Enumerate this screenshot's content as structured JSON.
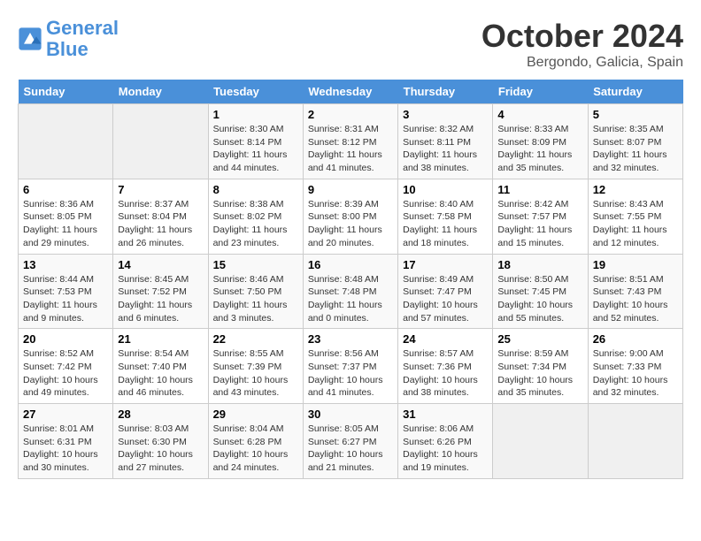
{
  "header": {
    "logo_line1": "General",
    "logo_line2": "Blue",
    "month": "October 2024",
    "location": "Bergondo, Galicia, Spain"
  },
  "weekdays": [
    "Sunday",
    "Monday",
    "Tuesday",
    "Wednesday",
    "Thursday",
    "Friday",
    "Saturday"
  ],
  "weeks": [
    [
      {
        "day": "",
        "info": ""
      },
      {
        "day": "",
        "info": ""
      },
      {
        "day": "1",
        "info": "Sunrise: 8:30 AM\nSunset: 8:14 PM\nDaylight: 11 hours and 44 minutes."
      },
      {
        "day": "2",
        "info": "Sunrise: 8:31 AM\nSunset: 8:12 PM\nDaylight: 11 hours and 41 minutes."
      },
      {
        "day": "3",
        "info": "Sunrise: 8:32 AM\nSunset: 8:11 PM\nDaylight: 11 hours and 38 minutes."
      },
      {
        "day": "4",
        "info": "Sunrise: 8:33 AM\nSunset: 8:09 PM\nDaylight: 11 hours and 35 minutes."
      },
      {
        "day": "5",
        "info": "Sunrise: 8:35 AM\nSunset: 8:07 PM\nDaylight: 11 hours and 32 minutes."
      }
    ],
    [
      {
        "day": "6",
        "info": "Sunrise: 8:36 AM\nSunset: 8:05 PM\nDaylight: 11 hours and 29 minutes."
      },
      {
        "day": "7",
        "info": "Sunrise: 8:37 AM\nSunset: 8:04 PM\nDaylight: 11 hours and 26 minutes."
      },
      {
        "day": "8",
        "info": "Sunrise: 8:38 AM\nSunset: 8:02 PM\nDaylight: 11 hours and 23 minutes."
      },
      {
        "day": "9",
        "info": "Sunrise: 8:39 AM\nSunset: 8:00 PM\nDaylight: 11 hours and 20 minutes."
      },
      {
        "day": "10",
        "info": "Sunrise: 8:40 AM\nSunset: 7:58 PM\nDaylight: 11 hours and 18 minutes."
      },
      {
        "day": "11",
        "info": "Sunrise: 8:42 AM\nSunset: 7:57 PM\nDaylight: 11 hours and 15 minutes."
      },
      {
        "day": "12",
        "info": "Sunrise: 8:43 AM\nSunset: 7:55 PM\nDaylight: 11 hours and 12 minutes."
      }
    ],
    [
      {
        "day": "13",
        "info": "Sunrise: 8:44 AM\nSunset: 7:53 PM\nDaylight: 11 hours and 9 minutes."
      },
      {
        "day": "14",
        "info": "Sunrise: 8:45 AM\nSunset: 7:52 PM\nDaylight: 11 hours and 6 minutes."
      },
      {
        "day": "15",
        "info": "Sunrise: 8:46 AM\nSunset: 7:50 PM\nDaylight: 11 hours and 3 minutes."
      },
      {
        "day": "16",
        "info": "Sunrise: 8:48 AM\nSunset: 7:48 PM\nDaylight: 11 hours and 0 minutes."
      },
      {
        "day": "17",
        "info": "Sunrise: 8:49 AM\nSunset: 7:47 PM\nDaylight: 10 hours and 57 minutes."
      },
      {
        "day": "18",
        "info": "Sunrise: 8:50 AM\nSunset: 7:45 PM\nDaylight: 10 hours and 55 minutes."
      },
      {
        "day": "19",
        "info": "Sunrise: 8:51 AM\nSunset: 7:43 PM\nDaylight: 10 hours and 52 minutes."
      }
    ],
    [
      {
        "day": "20",
        "info": "Sunrise: 8:52 AM\nSunset: 7:42 PM\nDaylight: 10 hours and 49 minutes."
      },
      {
        "day": "21",
        "info": "Sunrise: 8:54 AM\nSunset: 7:40 PM\nDaylight: 10 hours and 46 minutes."
      },
      {
        "day": "22",
        "info": "Sunrise: 8:55 AM\nSunset: 7:39 PM\nDaylight: 10 hours and 43 minutes."
      },
      {
        "day": "23",
        "info": "Sunrise: 8:56 AM\nSunset: 7:37 PM\nDaylight: 10 hours and 41 minutes."
      },
      {
        "day": "24",
        "info": "Sunrise: 8:57 AM\nSunset: 7:36 PM\nDaylight: 10 hours and 38 minutes."
      },
      {
        "day": "25",
        "info": "Sunrise: 8:59 AM\nSunset: 7:34 PM\nDaylight: 10 hours and 35 minutes."
      },
      {
        "day": "26",
        "info": "Sunrise: 9:00 AM\nSunset: 7:33 PM\nDaylight: 10 hours and 32 minutes."
      }
    ],
    [
      {
        "day": "27",
        "info": "Sunrise: 8:01 AM\nSunset: 6:31 PM\nDaylight: 10 hours and 30 minutes."
      },
      {
        "day": "28",
        "info": "Sunrise: 8:03 AM\nSunset: 6:30 PM\nDaylight: 10 hours and 27 minutes."
      },
      {
        "day": "29",
        "info": "Sunrise: 8:04 AM\nSunset: 6:28 PM\nDaylight: 10 hours and 24 minutes."
      },
      {
        "day": "30",
        "info": "Sunrise: 8:05 AM\nSunset: 6:27 PM\nDaylight: 10 hours and 21 minutes."
      },
      {
        "day": "31",
        "info": "Sunrise: 8:06 AM\nSunset: 6:26 PM\nDaylight: 10 hours and 19 minutes."
      },
      {
        "day": "",
        "info": ""
      },
      {
        "day": "",
        "info": ""
      }
    ]
  ]
}
